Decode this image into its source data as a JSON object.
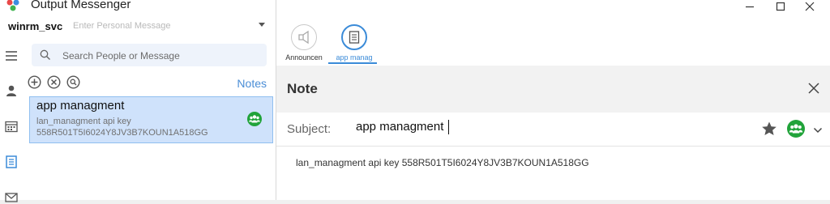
{
  "app": {
    "title": "Output Messenger"
  },
  "user": {
    "name": "winrm_svc",
    "status_placeholder": "Enter Personal Message"
  },
  "search": {
    "placeholder": "Search People or Message"
  },
  "notes_panel": {
    "label": "Notes",
    "items": [
      {
        "title": "app managment",
        "preview": "lan_managment  api key 558R501T5I6024Y8JV3B7KOUN1A518GG"
      }
    ]
  },
  "tabs": [
    {
      "label": "Announcen",
      "icon": "megaphone-icon",
      "active": false
    },
    {
      "label": "app manag",
      "icon": "note-icon",
      "active": true
    }
  ],
  "note": {
    "heading": "Note",
    "subject_label": "Subject:",
    "subject_value": "app managment",
    "body": "lan_managment  api key 558R501T5I6024Y8JV3B7KOUN1A518GG"
  },
  "colors": {
    "accent": "#3b8bd8",
    "selected_note_bg": "#cfe2fb",
    "group_green": "#21a33a",
    "notes_link": "#4a8dd6"
  }
}
